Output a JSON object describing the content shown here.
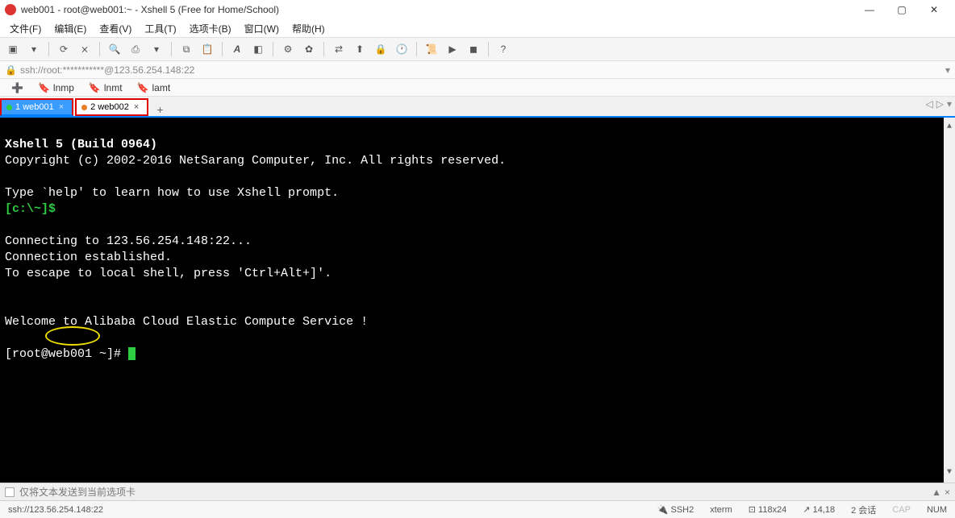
{
  "window": {
    "title": "web001 - root@web001:~ - Xshell 5 (Free for Home/School)"
  },
  "menu": {
    "file": "文件(F)",
    "edit": "编辑(E)",
    "view": "查看(V)",
    "tools": "工具(T)",
    "tabs": "选项卡(B)",
    "window": "窗口(W)",
    "help": "帮助(H)"
  },
  "addressbar": {
    "url": "ssh://root:***********@123.56.254.148:22"
  },
  "bookmarks": {
    "items": [
      {
        "label": "lnmp"
      },
      {
        "label": "lnmt"
      },
      {
        "label": "lamt"
      }
    ]
  },
  "session_tabs": {
    "items": [
      {
        "num": "1",
        "label": "web001",
        "active": true
      },
      {
        "num": "2",
        "label": "web002",
        "active": false
      }
    ]
  },
  "terminal": {
    "line_header": "Xshell 5 (Build 0964)",
    "line_copyright": "Copyright (c) 2002-2016 NetSarang Computer, Inc. All rights reserved.",
    "line_help": "Type `help' to learn how to use Xshell prompt.",
    "prompt1": "[c:\\~]$",
    "line_connecting": "Connecting to 123.56.254.148:22...",
    "line_established": "Connection established.",
    "line_escape": "To escape to local shell, press 'Ctrl+Alt+]'.",
    "line_welcome": "Welcome to Alibaba Cloud Elastic Compute Service !",
    "prompt2_pre": "[root@",
    "prompt2_host": "web001",
    "prompt2_post": " ~]# "
  },
  "inputbar": {
    "text": "仅将文本发送到当前选项卡"
  },
  "statusbar": {
    "left": "ssh://123.56.254.148:22",
    "ssh": "SSH2",
    "term": "xterm",
    "size": "118x24",
    "pos": "14,18",
    "sessions": "2 会话",
    "cap": "CAP",
    "num": "NUM"
  }
}
